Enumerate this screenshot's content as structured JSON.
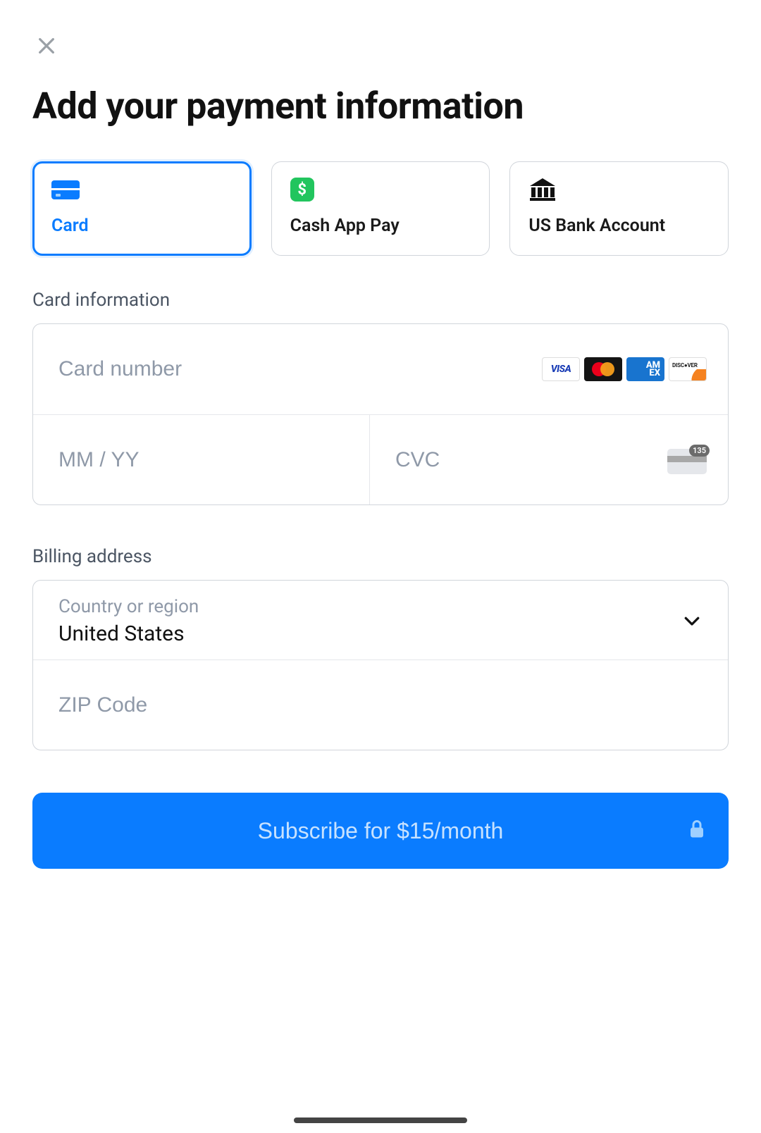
{
  "title": "Add your payment information",
  "payment_methods": {
    "card": "Card",
    "cashapp": "Cash App Pay",
    "bank": "US Bank Account"
  },
  "card_info": {
    "section_label": "Card information",
    "number_placeholder": "Card number",
    "expiry_placeholder": "MM / YY",
    "cvc_placeholder": "CVC",
    "cvc_hint": "135"
  },
  "billing": {
    "section_label": "Billing address",
    "country_label": "Country or region",
    "country_value": "United States",
    "zip_placeholder": "ZIP Code"
  },
  "subscribe_label": "Subscribe for $15/month",
  "colors": {
    "primary": "#0a7cff"
  }
}
